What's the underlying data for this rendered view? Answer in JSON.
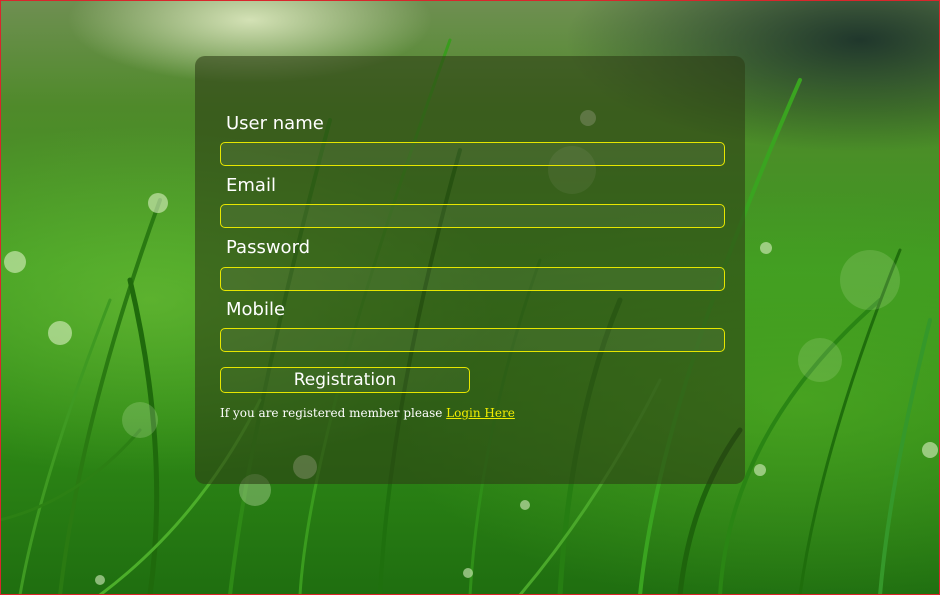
{
  "form": {
    "fields": [
      {
        "label": "User name",
        "value": ""
      },
      {
        "label": "Email",
        "value": ""
      },
      {
        "label": "Password",
        "value": ""
      },
      {
        "label": "Mobile",
        "value": ""
      }
    ],
    "submit_label": "Registration",
    "hint_text": "If you are registered member please ",
    "login_link": "Login Here"
  },
  "colors": {
    "accent": "#e6e600",
    "link": "#f2ee00",
    "card_background": "rgba(45,60,20,0.58)",
    "text": "#ffffff",
    "border": "#d9262c"
  }
}
